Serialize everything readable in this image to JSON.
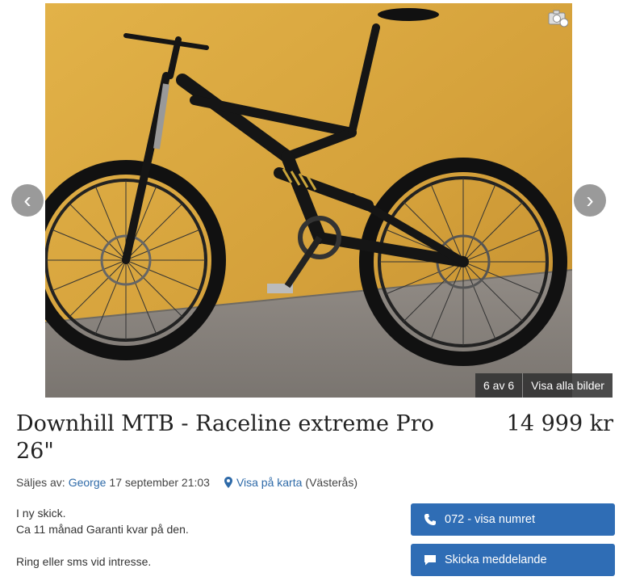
{
  "gallery": {
    "counter": "6 av 6",
    "show_all": "Visa alla bilder",
    "prev_icon": "chevron-left-icon",
    "next_icon": "chevron-right-icon",
    "prev_glyph": "‹",
    "next_glyph": "›"
  },
  "listing": {
    "title": "Downhill MTB - Raceline extreme Pro 26\"",
    "price": "14 999 kr",
    "seller_prefix": "Säljes av:",
    "seller_name": "George",
    "posted": "17 september 21:03",
    "map_link": "Visa på karta",
    "location": "(Västerås)",
    "description": [
      "I ny skick.",
      "Ca 11 månad Garanti kvar på den.",
      "",
      "Ring eller sms vid intresse."
    ]
  },
  "actions": {
    "phone_label": "072 - visa numret",
    "message_label": "Skicka meddelande"
  },
  "colors": {
    "primary_button": "#2f6db5",
    "link": "#2e6aa8",
    "wall": "#d9a53c",
    "floor": "#8a8580"
  }
}
